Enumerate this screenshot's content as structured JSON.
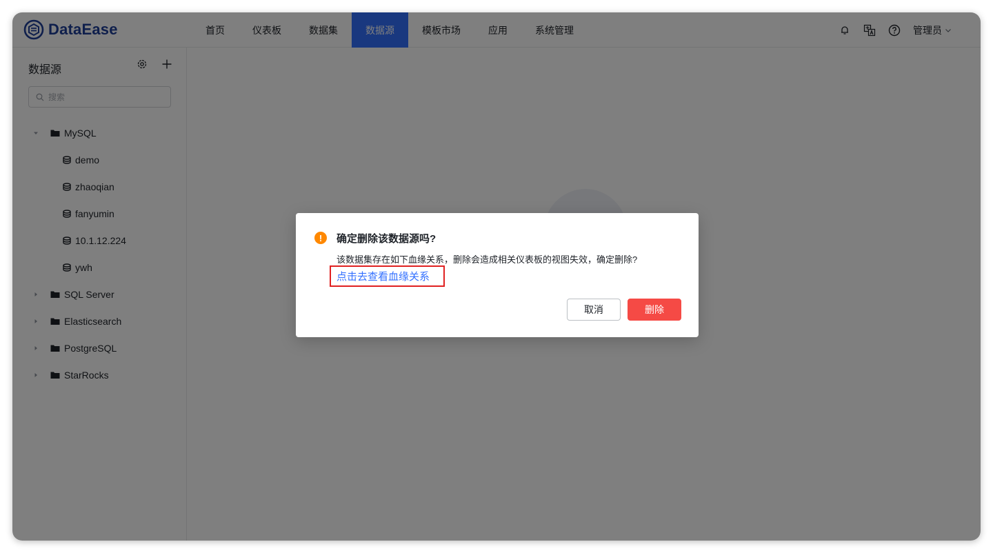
{
  "app": {
    "logo_text": "DataEase",
    "brand_color": "#1f3f99",
    "accent_color": "#3370ff"
  },
  "nav": {
    "items": [
      {
        "label": "首页"
      },
      {
        "label": "仪表板"
      },
      {
        "label": "数据集"
      },
      {
        "label": "数据源",
        "active": true
      },
      {
        "label": "模板市场"
      },
      {
        "label": "应用"
      },
      {
        "label": "系统管理"
      }
    ]
  },
  "header_right": {
    "icons": [
      "bell-icon",
      "translate-icon",
      "help-icon"
    ],
    "user_label": "管理员"
  },
  "sidebar": {
    "title": "数据源",
    "actions": [
      "settings-icon",
      "add-icon"
    ],
    "search_placeholder": "搜索",
    "tree": [
      {
        "label": "MySQL",
        "type": "folder",
        "expanded": true
      },
      {
        "label": "demo",
        "type": "datasource"
      },
      {
        "label": "zhaoqian",
        "type": "datasource"
      },
      {
        "label": "fanyumin",
        "type": "datasource"
      },
      {
        "label": "10.1.12.224",
        "type": "datasource"
      },
      {
        "label": "ywh",
        "type": "datasource"
      },
      {
        "label": "SQL Server",
        "type": "folder",
        "expanded": false
      },
      {
        "label": "Elasticsearch",
        "type": "folder",
        "expanded": false
      },
      {
        "label": "PostgreSQL",
        "type": "folder",
        "expanded": false
      },
      {
        "label": "StarRocks",
        "type": "folder",
        "expanded": false
      }
    ]
  },
  "dialog": {
    "title": "确定删除该数据源吗?",
    "message": "该数据集存在如下血缘关系，删除会造成相关仪表板的视图失效，确定删除?",
    "link": "点击去查看血缘关系",
    "cancel_label": "取消",
    "delete_label": "删除",
    "warning_color": "#ff8800",
    "danger_color": "#f54a45"
  }
}
